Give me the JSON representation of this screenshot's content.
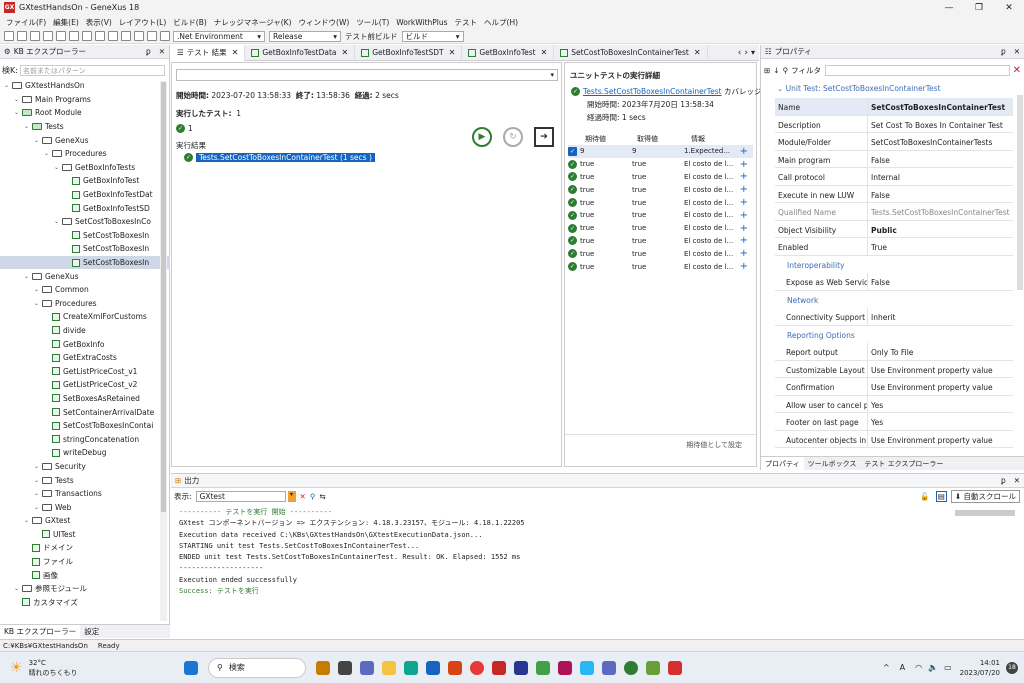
{
  "window": {
    "title": "GXtestHandsOn - GeneXus 18",
    "logo": "GX"
  },
  "menu": [
    "ファイル(F)",
    "編集(E)",
    "表示(V)",
    "レイアウト(L)",
    "ビルド(B)",
    "ナレッジマネージャ(K)",
    "ウィンドウ(W)",
    "ツール(T)",
    "WorkWithPlus",
    "テスト",
    "ヘルプ(H)"
  ],
  "toolbar": {
    "environment": ".Net Environment",
    "configuration": "Release",
    "build_label": "テスト前ビルド",
    "build_action": "ビルド"
  },
  "kb_explorer": {
    "title": "KB エクスプローラー",
    "filter_label": "検K:",
    "filter_placeholder": "名前またはパターン",
    "items": [
      {
        "label": "GXtestHandsOn",
        "indent": 0,
        "kind": "kb"
      },
      {
        "label": "Main Programs",
        "indent": 1,
        "kind": "folder"
      },
      {
        "label": "Root Module",
        "indent": 1,
        "kind": "module"
      },
      {
        "label": "Tests",
        "indent": 2,
        "kind": "module"
      },
      {
        "label": "GeneXus",
        "indent": 3,
        "kind": "folder"
      },
      {
        "label": "Procedures",
        "indent": 4,
        "kind": "folder"
      },
      {
        "label": "GetBoxInfoTests",
        "indent": 5,
        "kind": "folder"
      },
      {
        "label": "GetBoxInfoTest",
        "indent": 6,
        "kind": "obj"
      },
      {
        "label": "GetBoxInfoTestDat",
        "indent": 6,
        "kind": "obj"
      },
      {
        "label": "GetBoxInfoTestSD",
        "indent": 6,
        "kind": "obj"
      },
      {
        "label": "SetCostToBoxesInCo",
        "indent": 5,
        "kind": "folder"
      },
      {
        "label": "SetCostToBoxesIn",
        "indent": 6,
        "kind": "obj"
      },
      {
        "label": "SetCostToBoxesIn",
        "indent": 6,
        "kind": "obj"
      },
      {
        "label": "SetCostToBoxesIn",
        "indent": 6,
        "kind": "obj",
        "selected": true
      },
      {
        "label": "GeneXus",
        "indent": 2,
        "kind": "folder"
      },
      {
        "label": "Common",
        "indent": 3,
        "kind": "folder"
      },
      {
        "label": "Procedures",
        "indent": 3,
        "kind": "folder"
      },
      {
        "label": "CreateXmlForCustoms",
        "indent": 4,
        "kind": "obj"
      },
      {
        "label": "divide",
        "indent": 4,
        "kind": "obj"
      },
      {
        "label": "GetBoxInfo",
        "indent": 4,
        "kind": "obj"
      },
      {
        "label": "GetExtraCosts",
        "indent": 4,
        "kind": "obj"
      },
      {
        "label": "GetListPriceCost_v1",
        "indent": 4,
        "kind": "obj"
      },
      {
        "label": "GetListPriceCost_v2",
        "indent": 4,
        "kind": "obj"
      },
      {
        "label": "SetBoxesAsRetained",
        "indent": 4,
        "kind": "obj"
      },
      {
        "label": "SetContainerArrivalDate",
        "indent": 4,
        "kind": "obj"
      },
      {
        "label": "SetCostToBoxesInContai",
        "indent": 4,
        "kind": "obj"
      },
      {
        "label": "stringConcatenation",
        "indent": 4,
        "kind": "obj"
      },
      {
        "label": "writeDebug",
        "indent": 4,
        "kind": "obj"
      },
      {
        "label": "Security",
        "indent": 3,
        "kind": "folder"
      },
      {
        "label": "Tests",
        "indent": 3,
        "kind": "folder"
      },
      {
        "label": "Transactions",
        "indent": 3,
        "kind": "folder"
      },
      {
        "label": "Web",
        "indent": 3,
        "kind": "folder"
      },
      {
        "label": "GXtest",
        "indent": 2,
        "kind": "folder"
      },
      {
        "label": "UITest",
        "indent": 3,
        "kind": "obj"
      },
      {
        "label": "ドメイン",
        "indent": 2,
        "kind": "obj"
      },
      {
        "label": "ファイル",
        "indent": 2,
        "kind": "obj"
      },
      {
        "label": "画像",
        "indent": 2,
        "kind": "obj"
      },
      {
        "label": "参照モジュール",
        "indent": 1,
        "kind": "folder"
      },
      {
        "label": "カスタマイズ",
        "indent": 1,
        "kind": "obj"
      }
    ],
    "bottom_tabs": [
      "KB エクスプローラー",
      "設定"
    ]
  },
  "tabs": [
    "テスト 結果",
    "GetBoxInfoTestData",
    "GetBoxInfoTestSDT",
    "GetBoxInfoTest",
    "SetCostToBoxesInContainerTest"
  ],
  "results": {
    "start_label": "開始時間:",
    "start": "2023-07-20 13:58:33",
    "end_label": "終了:",
    "end": "13:58:36",
    "duration_label": "経過:",
    "duration": "2 secs",
    "run_label": "実行したテスト:",
    "run_count": "1",
    "passed": "1",
    "section": "実行結果",
    "test_item": "Tests.SetCostToBoxesInContainerTest (1 secs )"
  },
  "detail": {
    "title": "ユニットテストの実行詳細",
    "link": "Tests.SetCostToBoxesInContainerTest",
    "coverage": "カバレッジ",
    "start_label": "開始時間:",
    "start": "2023年7月20日 13:58:34",
    "duration_label": "経過時間:",
    "duration": "1 secs",
    "headers": [
      "期待値",
      "取得値",
      "情報"
    ],
    "rows": [
      [
        "9",
        "9",
        "1.Expected..."
      ],
      [
        "true",
        "true",
        "El costo de l..."
      ],
      [
        "true",
        "true",
        "El costo de l..."
      ],
      [
        "true",
        "true",
        "El costo de l..."
      ],
      [
        "true",
        "true",
        "El costo de l..."
      ],
      [
        "true",
        "true",
        "El costo de l..."
      ],
      [
        "true",
        "true",
        "El costo de l..."
      ],
      [
        "true",
        "true",
        "El costo de l..."
      ],
      [
        "true",
        "true",
        "El costo de l..."
      ],
      [
        "true",
        "true",
        "El costo de l..."
      ]
    ],
    "set_expected": "期待値として設定"
  },
  "properties": {
    "title": "プロパティ",
    "filter": "フィルタ",
    "header": "Unit Test: SetCostToBoxesInContainerTest",
    "rows": [
      {
        "k": "Name",
        "v": "SetCostToBoxesInContainerTest",
        "bold": true
      },
      {
        "k": "Description",
        "v": "Set Cost To Boxes In Container Test"
      },
      {
        "k": "Module/Folder",
        "v": "SetCostToBoxesInContainerTests"
      },
      {
        "k": "Main program",
        "v": "False"
      },
      {
        "k": "Call protocol",
        "v": "Internal"
      },
      {
        "k": "Execute in new LUW",
        "v": "False"
      },
      {
        "k": "Qualified Name",
        "v": "Tests.SetCostToBoxesInContainerTest",
        "grey": true
      },
      {
        "k": "Object Visibility",
        "v": "Public",
        "bold": true
      },
      {
        "k": "Enabled",
        "v": "True"
      },
      {
        "group": "Interoperability"
      },
      {
        "k": "Expose as Web Service",
        "v": "False",
        "sub": true
      },
      {
        "group": "Network"
      },
      {
        "k": "Connectivity Support",
        "v": "Inherit",
        "sub": true
      },
      {
        "group": "Reporting Options"
      },
      {
        "k": "Report output",
        "v": "Only To File",
        "sub": true
      },
      {
        "k": "Customizable Layout",
        "v": "Use Environment property value",
        "sub": true
      },
      {
        "k": "Confirmation",
        "v": "Use Environment property value",
        "sub": true
      },
      {
        "k": "Allow user to cancel pro",
        "v": "Yes",
        "sub": true
      },
      {
        "k": "Footer on last page",
        "v": "Yes",
        "sub": true
      },
      {
        "k": "Autocenter objects in (C",
        "v": "Use Environment property value",
        "sub": true
      }
    ],
    "bottom_tabs": [
      "プロパティ",
      "ツールボックス",
      "テスト エクスプローラー"
    ]
  },
  "output": {
    "title": "出力",
    "show_label": "表示:",
    "source": "GXtest",
    "autoscroll": "自動スクロール",
    "lines": [
      {
        "t": "---------- テストを実行 開始 ----------",
        "c": "green"
      },
      {
        "t": "GXtest コンポーネントバージョン => エクステンション: 4.18.3.23157、モジュール: 4.18.1.22205"
      },
      {
        "t": "Execution data received C:\\KBs\\GXtestHandsOn\\GXtestExecutionData.json..."
      },
      {
        "t": "STARTING unit test Tests.SetCostToBoxesInContainerTest..."
      },
      {
        "t": "ENDED unit test Tests.SetCostToBoxesInContainerTest. Result: OK. Elapsed: 1552 ms"
      },
      {
        "t": "--------------------"
      },
      {
        "t": "Execution ended successfully"
      },
      {
        "t": "Success: テストを実行",
        "c": "green"
      }
    ]
  },
  "status": {
    "path": "C:¥KBs¥GXtestHandsOn",
    "state": "Ready"
  },
  "taskbar": {
    "temp": "32°C",
    "weather": "晴れのちくもり",
    "search": "検索",
    "time": "14:01",
    "date": "2023/07/20",
    "ime": "A",
    "notif": "18"
  }
}
